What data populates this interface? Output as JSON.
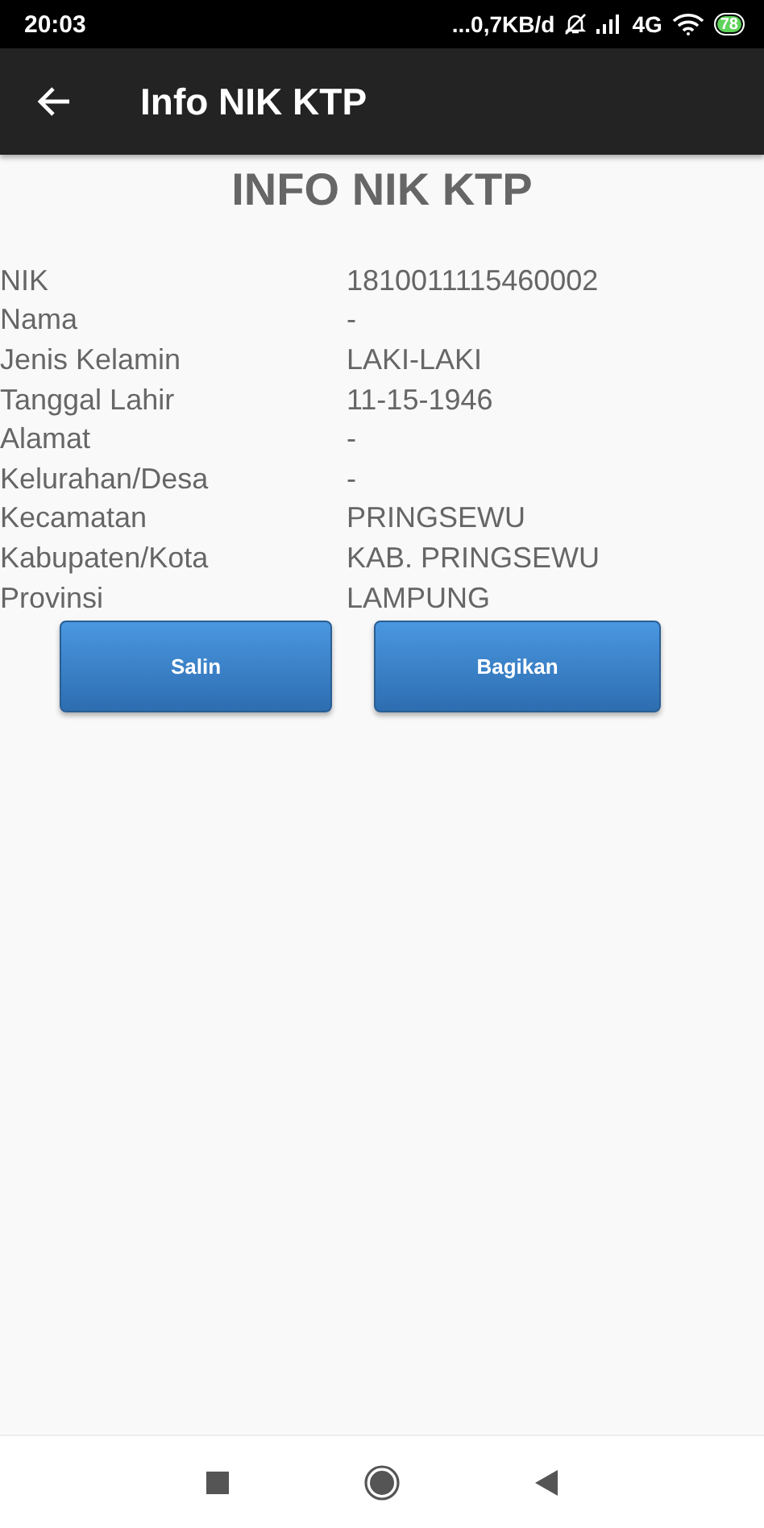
{
  "status_bar": {
    "time": "20:03",
    "net_speed": "...0,7KB/d",
    "network": "4G",
    "battery": "78"
  },
  "app_bar": {
    "title": "Info NIK KTP"
  },
  "heading": "INFO NIK KTP",
  "fields": [
    {
      "label": "NIK",
      "value": "1810011115460002"
    },
    {
      "label": "Nama",
      "value": "-"
    },
    {
      "label": "Jenis Kelamin",
      "value": "LAKI-LAKI"
    },
    {
      "label": "Tanggal Lahir",
      "value": "11-15-1946"
    },
    {
      "label": "Alamat",
      "value": "-"
    },
    {
      "label": "Kelurahan/Desa",
      "value": "-"
    },
    {
      "label": "Kecamatan",
      "value": "PRINGSEWU"
    },
    {
      "label": "Kabupaten/Kota",
      "value": "KAB. PRINGSEWU"
    },
    {
      "label": "Provinsi",
      "value": "LAMPUNG"
    }
  ],
  "buttons": [
    "Salin",
    "Bagikan"
  ]
}
